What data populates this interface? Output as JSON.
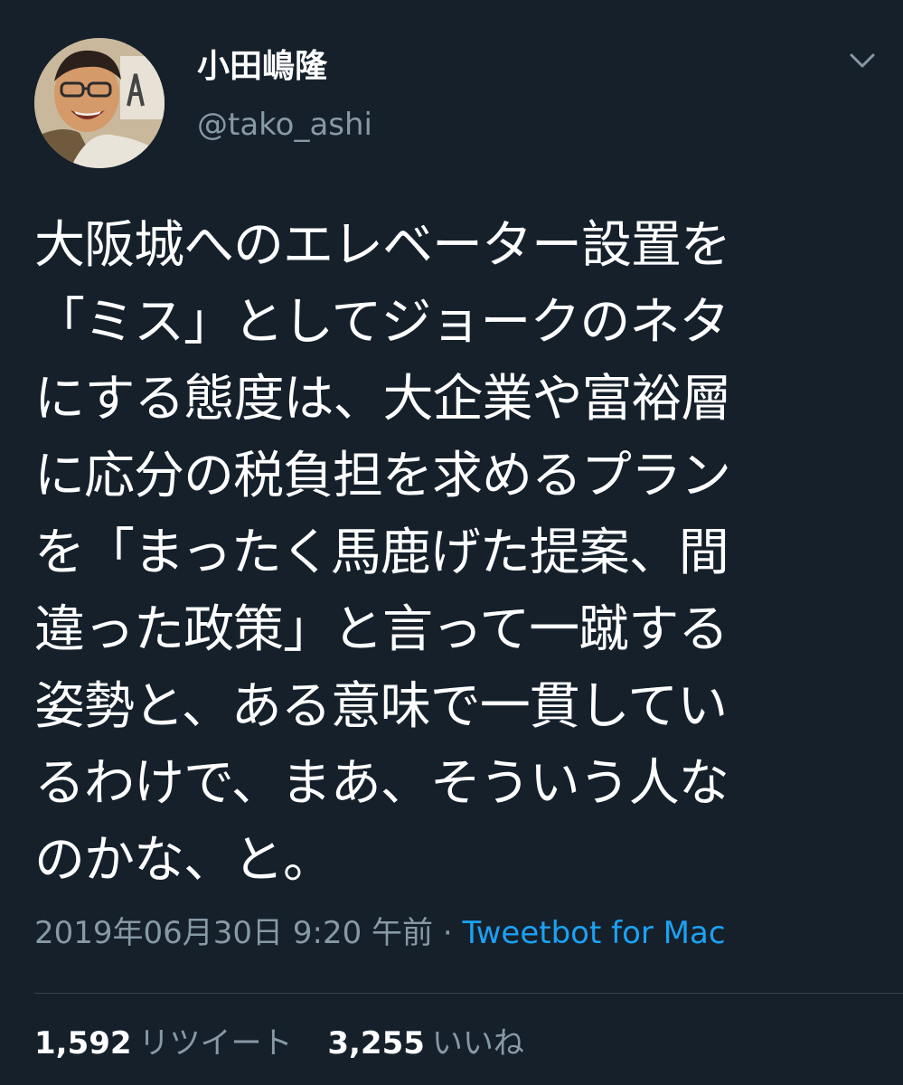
{
  "user": {
    "display_name": "小田嶋隆",
    "handle": "@tako_ashi",
    "avatar_icon": "avatar-photo"
  },
  "menu": {
    "caret_icon": "chevron-down-icon"
  },
  "tweet": {
    "lines": [
      "大阪城へのエレベーター設置を",
      "「ミス」としてジョークのネタ",
      "にする態度は、大企業や富裕層",
      "に応分の税負担を求めるプラン",
      "を「まったく馬鹿げた提案、間",
      "違った政策」と言って一蹴する",
      "姿勢と、ある意味で一貫してい",
      "るわけで、まあ、そういう人な",
      "のかな、と。"
    ]
  },
  "meta": {
    "timestamp": "2019年06月30日 9:20 午前",
    "separator": " · ",
    "source": "Tweetbot for Mac"
  },
  "stats": {
    "retweets": {
      "count": "1,592",
      "label": "リツイート"
    },
    "likes": {
      "count": "3,255",
      "label": "いいね"
    }
  },
  "colors": {
    "background": "#15202b",
    "text": "#ffffff",
    "secondary_text": "#8899a6",
    "link": "#1da1f2",
    "divider": "#38444d"
  }
}
